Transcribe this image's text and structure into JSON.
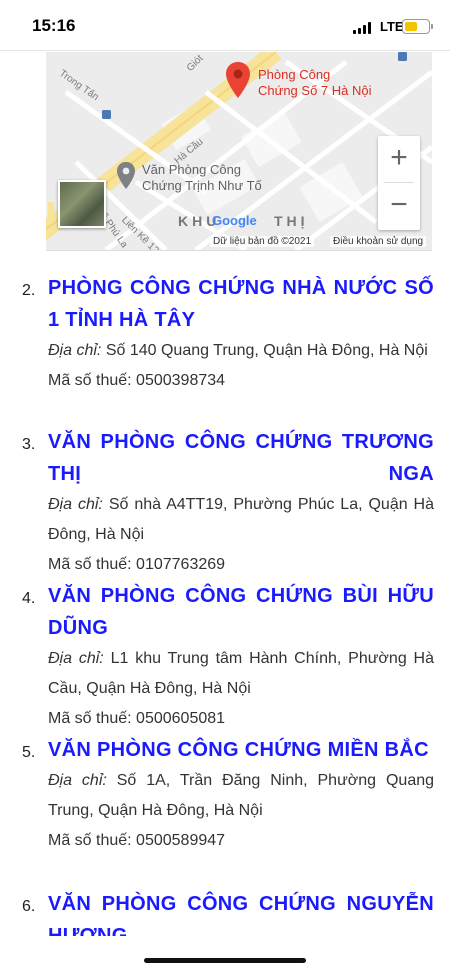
{
  "status": {
    "time": "15:16",
    "network": "LTE",
    "battery_color": "#f5c400"
  },
  "map": {
    "pin_label_1": "Phòng Công",
    "pin_label_2": "Chứng Số 7 Hà Nội",
    "place_label_1": "Văn Phòng Công",
    "place_label_2": "Chứng Trịnh Như Tố",
    "streets": [
      "Trong Tấn",
      "Giót",
      "Hà Cầu",
      "Phố Phú La",
      "Liên Kề 12"
    ],
    "area_label": "KHU",
    "area_label_2": "THỊ",
    "google": "Google",
    "attribution": "Dữ liệu bản đồ ©2021",
    "terms": "Điều khoản sử dụng",
    "zoom_in": "+",
    "zoom_out": "−"
  },
  "entries": [
    {
      "num": "2.",
      "title": "PHÒNG CÔNG CHỨNG NHÀ NƯỚC SỐ 1 TỈNH HÀ TÂY",
      "address_label": "Địa chỉ:",
      "address": "Số 140 Quang Trung, Quận Hà Đông, Hà Nội",
      "tax": "Mã số thuế: 0500398734"
    },
    {
      "num": "3.",
      "title": "VĂN PHÒNG CÔNG CHỨNG TRƯƠNG THỊ NGA",
      "address_label": "Địa chỉ:",
      "address": "Số nhà A4TT19, Phường Phúc La, Quận Hà Đông, Hà Nội",
      "tax": "Mã số thuế: 0107763269"
    },
    {
      "num": "4.",
      "title": "VĂN PHÒNG CÔNG CHỨNG BÙI HỮU DŨNG",
      "address_label": "Địa chỉ:",
      "address": "L1 khu Trung tâm Hành Chính, Phường Hà Cầu, Quận Hà Đông, Hà Nội",
      "tax": "Mã số thuế: 0500605081"
    },
    {
      "num": "5.",
      "title": "VĂN PHÒNG CÔNG CHỨNG MIỀN BẮC",
      "address_label": "Địa chỉ:",
      "address": "Số 1A, Trần Đăng Ninh, Phường Quang Trung, Quận Hà Đông, Hà Nội",
      "tax": "Mã số thuế: 0500589947"
    },
    {
      "num": "6.",
      "title": "VĂN PHÒNG CÔNG CHỨNG NGUYỄN HƯƠNG"
    }
  ],
  "colors": {
    "title": "#1a1aff",
    "pin": "#d93025"
  }
}
